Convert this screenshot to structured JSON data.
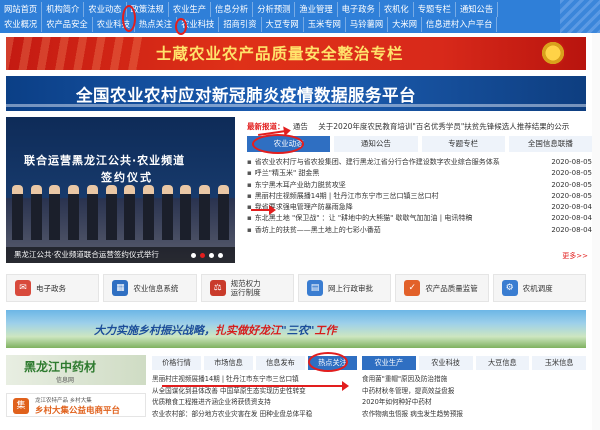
{
  "nav": {
    "row1": [
      "网站首页",
      "机构简介",
      "农业动态",
      "政策法规",
      "农业生产",
      "信息分析",
      "分析预测",
      "渔业管理",
      "电子政务",
      "农机化",
      "专题专栏",
      "通知公告"
    ],
    "row2": [
      "农业概况",
      "农产品安全",
      "农业科技",
      "热点关注",
      "农业科技",
      "招商引资",
      "大豆专网",
      "玉米专网",
      "马铃薯网",
      "大米网",
      "信息进村入户平台"
    ]
  },
  "banner1": {
    "text": "士蔵农业农产品质量安全整治专栏"
  },
  "banner2": {
    "text": "全国农业农村应对新冠肺炎疫情数据服务平台"
  },
  "photo": {
    "title1": "联合运营黑龙江公共·农业频道",
    "title2": "签约仪式",
    "caption": "黑龙江公共·农业频道联合运营签约仪式举行"
  },
  "latest": {
    "label": "最新报道：",
    "sub": "通告",
    "text": "关于2020年度农民教育培训\"百名优秀学员\"扶贫先锋候选人推荐结果的公示"
  },
  "tabs": [
    "农业动态",
    "通知公告",
    "专题专栏",
    "全国信息联播"
  ],
  "news": [
    {
      "text": "省农业农村厅与省农投集团、建行黑龙江省分行合作建设数字农业综合服务体系",
      "date": "2020-08-05"
    },
    {
      "text": "呼兰\"精玉米\" 甜金黑",
      "date": "2020-08-05"
    },
    {
      "text": "东宁黑木耳产业助力脱贫攻坚",
      "date": "2020-08-05"
    },
    {
      "text": "黑丽村庄视频展播14期 | 牡丹江市东宁市三岔口镇三岔口村",
      "date": "2020-08-05"
    },
    {
      "text": "我省要求强电管理产防暴雨急降",
      "date": "2020-08-04"
    },
    {
      "text": "东北黑土地 \"保卫战\" ：让 \"耕地中的大熊猫\" 歇歇气加加油 | 电讯特稿",
      "date": "2020-08-04"
    },
    {
      "text": "香坊上的扶贫——黑土地上的七彩小番茄",
      "date": "2020-08-04"
    }
  ],
  "more": "更多>>",
  "services": [
    {
      "label": "电子政务",
      "icon": "✉",
      "color": "#d84a3c"
    },
    {
      "label": "农业信息系统",
      "icon": "▦",
      "color": "#2f6fc2"
    },
    {
      "label": "规范权力\n运行制度",
      "icon": "⚖",
      "color": "#c93b2b"
    },
    {
      "label": "网上行政审批",
      "icon": "▤",
      "color": "#3a7dd1"
    },
    {
      "label": "农产品质量监管",
      "icon": "✓",
      "color": "#e2612a"
    },
    {
      "label": "农机调度",
      "icon": "⚙",
      "color": "#3a7dd1"
    }
  ],
  "banner3": {
    "a": "大力实施乡村振兴战略，",
    "b": "扎实做好龙江",
    "c": "\"三农\"",
    "d": "工作"
  },
  "herb": {
    "text": "黑龙江中药材",
    "sub": "信息网"
  },
  "market": {
    "small": "龙江农特产品 乡村大集",
    "text": "乡村大集公益电商平台"
  },
  "mid_tabs": [
    "价格行情",
    "市场信息",
    "信息发布",
    "热点关注"
  ],
  "mid_list": [
    "黑丽村庄视频展播14期 | 牡丹江市东宁市三岔口镇",
    "从全国谋化到县体改善 中国草原生态实现历史性转变",
    "优质粮食工程推进齐涵企业将获债资支持",
    "农业农村部：部分地方农业灾害在发 田种业盘总体平稳"
  ],
  "right_tabs": [
    "农业生产",
    "农业科技",
    "大豆信息",
    "玉米信息"
  ],
  "right_list": [
    "食用菌\"重帽\"原因及防治措施",
    "中药材秋冬管理，提高效益盘报",
    "2020年如何种好中药材",
    "农作物病虫悟报 病虫发生趋势预报"
  ]
}
